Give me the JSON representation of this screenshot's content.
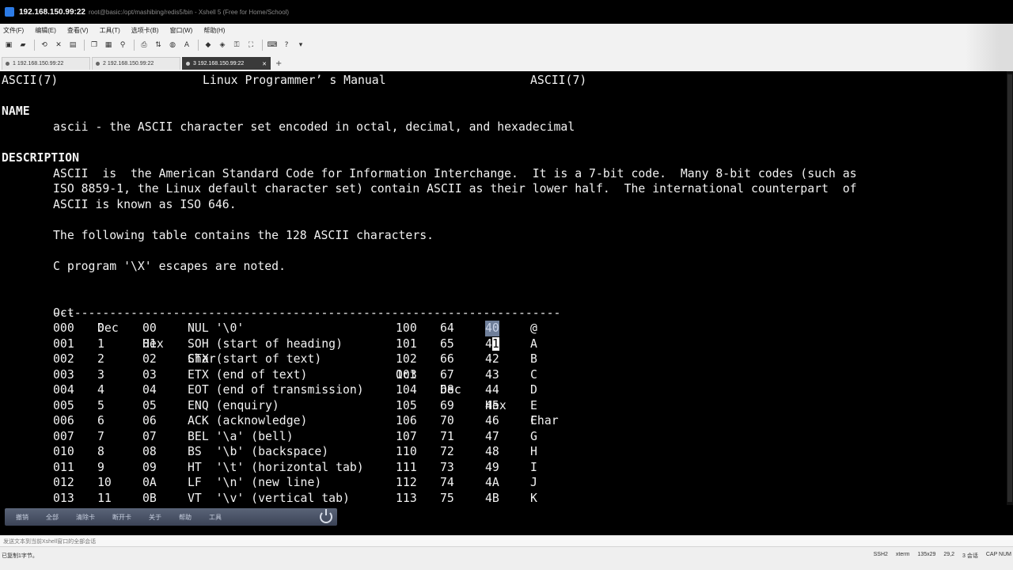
{
  "window": {
    "host": "192.168.150.99:22",
    "title_rest": "root@basic:/opt/mashibing/redis5/bin - Xshell 5 (Free for Home/School)"
  },
  "menu": [
    "文件(F)",
    "编辑(E)",
    "查看(V)",
    "工具(T)",
    "选项卡(B)",
    "窗口(W)",
    "帮助(H)"
  ],
  "tabs": [
    {
      "label": "1 192.168.150.99:22",
      "active": false
    },
    {
      "label": "2 192.168.150.99:22",
      "active": false
    },
    {
      "label": "3 192.168.150.99:22",
      "active": true
    }
  ],
  "terminal": {
    "header_left": "ASCII(7)",
    "header_center": "Linux Programmer’ s Manual",
    "header_right": "ASCII(7)",
    "name_heading": "NAME",
    "name_text": "ascii - the ASCII character set encoded in octal, decimal, and hexadecimal",
    "desc_heading": "DESCRIPTION",
    "desc_lines": [
      "ASCII  is  the American Standard Code for Information Interchange.  It is a 7-bit code.  Many 8-bit codes (such as",
      "ISO 8859-1, the Linux default character set) contain ASCII as their lower half.  The international counterpart  of",
      "ASCII is known as ISO 646."
    ],
    "table_intro": "The following table contains the 128 ASCII characters.",
    "escape_note": "C program '\\X' escapes are noted.",
    "table_headers": [
      "Oct",
      "Dec",
      "Hex",
      "Char",
      "Oct",
      "Dec",
      "Hex",
      "Char"
    ],
    "divider": "------------------------------------------------------------------------",
    "rows": [
      [
        "000",
        "0",
        "00",
        "NUL '\\0'",
        "100",
        "64",
        "40",
        "@"
      ],
      [
        "001",
        "1",
        "01",
        "SOH (start of heading)",
        "101",
        "65",
        "41",
        "A"
      ],
      [
        "002",
        "2",
        "02",
        "STX (start of text)",
        "102",
        "66",
        "42",
        "B"
      ],
      [
        "003",
        "3",
        "03",
        "ETX (end of text)",
        "103",
        "67",
        "43",
        "C"
      ],
      [
        "004",
        "4",
        "04",
        "EOT (end of transmission)",
        "104",
        "68",
        "44",
        "D"
      ],
      [
        "005",
        "5",
        "05",
        "ENQ (enquiry)",
        "105",
        "69",
        "45",
        "E"
      ],
      [
        "006",
        "6",
        "06",
        "ACK (acknowledge)",
        "106",
        "70",
        "46",
        "F"
      ],
      [
        "007",
        "7",
        "07",
        "BEL '\\a' (bell)",
        "107",
        "71",
        "47",
        "G"
      ],
      [
        "010",
        "8",
        "08",
        "BS  '\\b' (backspace)",
        "110",
        "72",
        "48",
        "H"
      ],
      [
        "011",
        "9",
        "09",
        "HT  '\\t' (horizontal tab)",
        "111",
        "73",
        "49",
        "I"
      ],
      [
        "012",
        "10",
        "0A",
        "LF  '\\n' (new line)",
        "112",
        "74",
        "4A",
        "J"
      ],
      [
        "013",
        "11",
        "0B",
        "VT  '\\v' (vertical tab)",
        "113",
        "75",
        "4B",
        "K"
      ]
    ]
  },
  "quickbar": [
    "撤销",
    "全部",
    "清除卡",
    "断开卡",
    "关于",
    "帮助",
    "工具"
  ],
  "compose_placeholder": "发送文本到当前Xshell窗口的全部会话",
  "status": {
    "left": "已复制1字节。",
    "right": [
      "SSH2",
      "xterm",
      "135x29",
      "29,2",
      "3 会话",
      "CAP NUM"
    ]
  }
}
